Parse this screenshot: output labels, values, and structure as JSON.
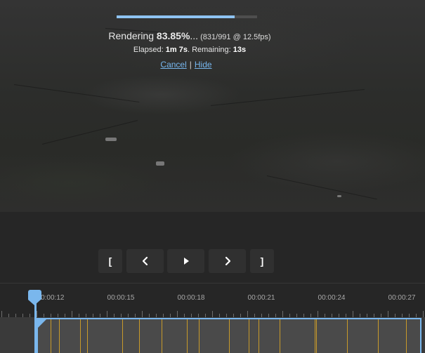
{
  "render": {
    "progress": 0.8385,
    "label": "Rendering ",
    "percent": "83.85%",
    "ellipsis": "...",
    "frames": " (831/991 @ 12.5fps)",
    "elapsed_label": "Elapsed: ",
    "elapsed": "1m 7s",
    "remaining_label": ". Remaining: ",
    "remaining": "13s",
    "cancel": "Cancel",
    "separator": "|",
    "hide": "Hide"
  },
  "controls": {
    "mark_in": "[",
    "mark_out": "]"
  },
  "timeline": {
    "labels": [
      "00:00:12",
      "00:00:15",
      "00:00:18",
      "00:00:21",
      "00:00:24",
      "00:00:27"
    ],
    "playhead": "00:00:12"
  },
  "colors": {
    "accent": "#7ab7ed",
    "progress": "#8ec3f2",
    "link": "#76b6ee",
    "cut_marker": "#c89a2a"
  }
}
